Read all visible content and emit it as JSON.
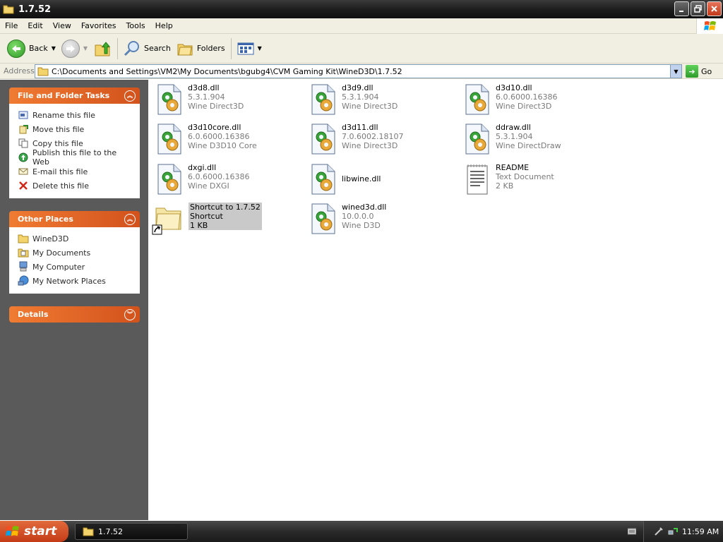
{
  "window": {
    "title": "1.7.52"
  },
  "menu": {
    "items": [
      "File",
      "Edit",
      "View",
      "Favorites",
      "Tools",
      "Help"
    ]
  },
  "toolbar": {
    "back_label": "Back",
    "search_label": "Search",
    "folders_label": "Folders"
  },
  "address": {
    "label": "Address",
    "path": "C:\\Documents and Settings\\VM2\\My Documents\\bgubg4\\CVM Gaming Kit\\WineD3D\\1.7.52",
    "go_label": "Go"
  },
  "tasks_panel": {
    "title": "File and Folder Tasks",
    "items": [
      {
        "label": "Rename this file",
        "icon": "rename-icon"
      },
      {
        "label": "Move this file",
        "icon": "move-icon"
      },
      {
        "label": "Copy this file",
        "icon": "copy-icon"
      },
      {
        "label": "Publish this file to the Web",
        "icon": "publish-icon"
      },
      {
        "label": "E-mail this file",
        "icon": "email-icon"
      },
      {
        "label": "Delete this file",
        "icon": "delete-icon"
      }
    ]
  },
  "places_panel": {
    "title": "Other Places",
    "items": [
      {
        "label": "WineD3D",
        "icon": "folder-icon"
      },
      {
        "label": "My Documents",
        "icon": "my-documents-icon"
      },
      {
        "label": "My Computer",
        "icon": "my-computer-icon"
      },
      {
        "label": "My Network Places",
        "icon": "network-icon"
      }
    ]
  },
  "details_panel": {
    "title": "Details"
  },
  "files": [
    {
      "name": "d3d8.dll",
      "line2": "5.3.1.904",
      "line3": "Wine Direct3D",
      "type": "dll"
    },
    {
      "name": "d3d9.dll",
      "line2": "5.3.1.904",
      "line3": "Wine Direct3D",
      "type": "dll"
    },
    {
      "name": "d3d10.dll",
      "line2": "6.0.6000.16386",
      "line3": "Wine Direct3D",
      "type": "dll"
    },
    {
      "name": "d3d10core.dll",
      "line2": "6.0.6000.16386",
      "line3": "Wine D3D10 Core",
      "type": "dll"
    },
    {
      "name": "d3d11.dll",
      "line2": "7.0.6002.18107",
      "line3": "Wine Direct3D",
      "type": "dll"
    },
    {
      "name": "ddraw.dll",
      "line2": "5.3.1.904",
      "line3": "Wine DirectDraw",
      "type": "dll"
    },
    {
      "name": "dxgi.dll",
      "line2": "6.0.6000.16386",
      "line3": "Wine DXGI",
      "type": "dll"
    },
    {
      "name": "libwine.dll",
      "line2": "",
      "line3": "",
      "type": "dll"
    },
    {
      "name": "README",
      "line2": "Text Document",
      "line3": "2 KB",
      "type": "text"
    },
    {
      "name": "Shortcut to 1.7.52",
      "line2": "Shortcut",
      "line3": "1 KB",
      "type": "shortcut"
    },
    {
      "name": "wined3d.dll",
      "line2": "10.0.0.0",
      "line3": "Wine D3D",
      "type": "dll"
    }
  ],
  "taskbar": {
    "start_label": "start",
    "task_label": "1.7.52",
    "clock": "11:59 AM"
  }
}
